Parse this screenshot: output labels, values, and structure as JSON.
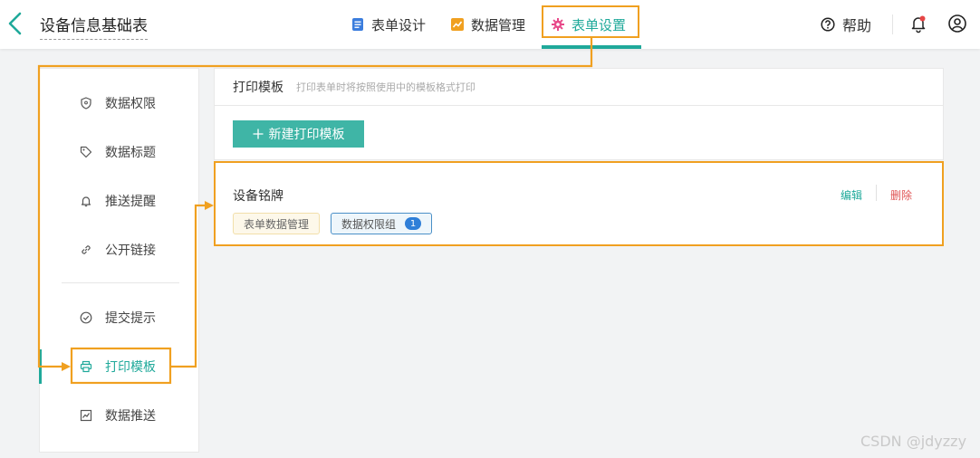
{
  "header": {
    "title": "设备信息基础表",
    "tabs": [
      {
        "label": "表单设计",
        "icon": "form-design-icon",
        "color": "#3b7ddd"
      },
      {
        "label": "数据管理",
        "icon": "data-chart-icon",
        "color": "#f0a020"
      },
      {
        "label": "表单设置",
        "icon": "gear-icon",
        "color": "#e84a8a",
        "active": true
      }
    ],
    "help_label": "帮助",
    "accent_color": "#1fa99a"
  },
  "sidebar": {
    "items": [
      {
        "label": "数据权限",
        "icon": "shield-icon"
      },
      {
        "label": "数据标题",
        "icon": "tag-icon"
      },
      {
        "label": "推送提醒",
        "icon": "bell-icon"
      },
      {
        "label": "公开链接",
        "icon": "link-icon"
      },
      {
        "label": "提交提示",
        "icon": "check-circle-icon"
      },
      {
        "label": "打印模板",
        "icon": "printer-icon",
        "active": true
      },
      {
        "label": "数据推送",
        "icon": "trend-chart-icon"
      }
    ]
  },
  "main": {
    "title": "打印模板",
    "description": "打印表单时将按照使用中的模板格式打印",
    "new_button_label": "新建打印模板",
    "templates": [
      {
        "name": "设备铭牌",
        "tags": [
          "表单数据管理",
          "数据权限组"
        ],
        "perm_count": "1",
        "edit_label": "编辑",
        "delete_label": "删除"
      }
    ]
  },
  "watermark": "CSDN @jdyzzy"
}
